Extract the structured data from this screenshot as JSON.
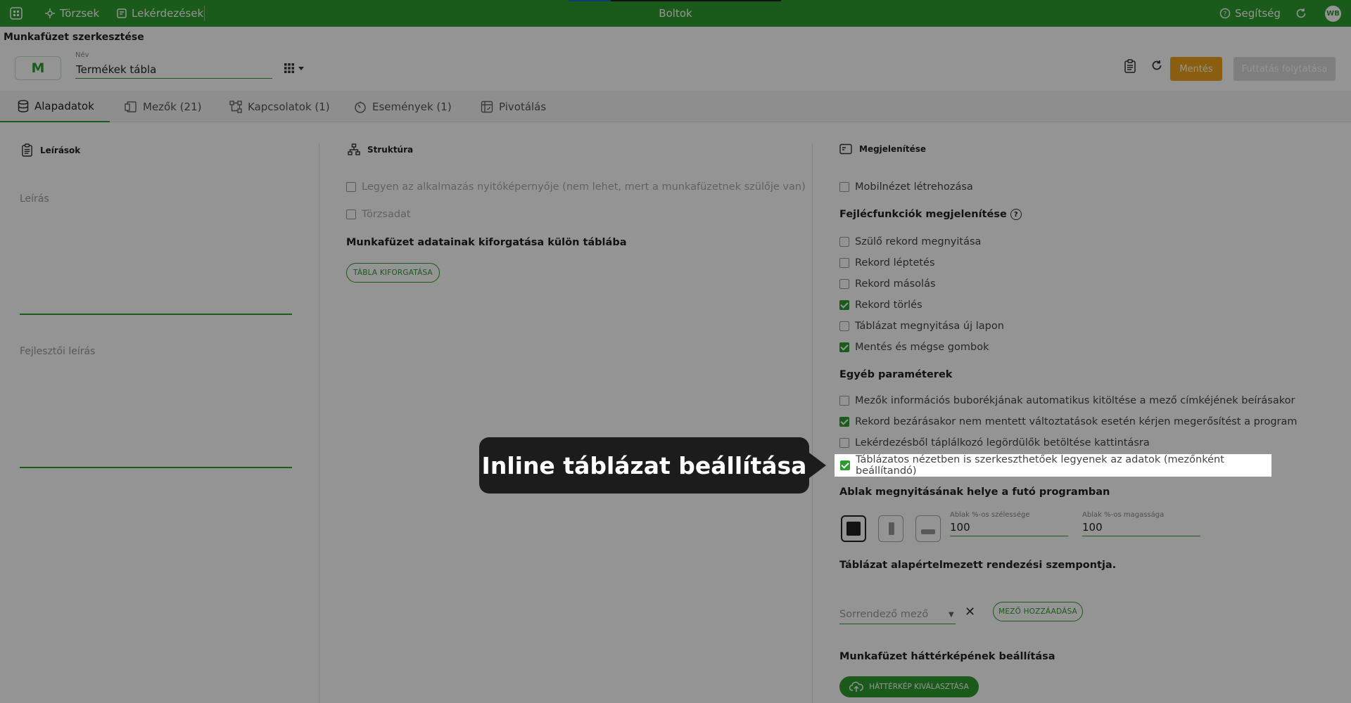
{
  "topbar": {
    "nav1": "Törzsek",
    "nav2": "Lekérdezések",
    "title": "Boltok",
    "help": "Segítség",
    "avatar": "WB",
    "color": "#2e9b2e"
  },
  "page_title": "Munkafüzet szerkesztése",
  "header": {
    "badge": "M",
    "name_label": "Név",
    "name_value": "Termékek tábla",
    "save": "Mentés",
    "run": "Futtatás folytatása",
    "save_color": "#f0a21b"
  },
  "tabs": [
    {
      "label": "Alapadatok",
      "icon": "database-icon"
    },
    {
      "label": "Mezők (21)",
      "icon": "fields-icon"
    },
    {
      "label": "Kapcsolatok (1)",
      "icon": "relations-icon"
    },
    {
      "label": "Események (1)",
      "icon": "events-icon"
    },
    {
      "label": "Pivotálás",
      "icon": "pivot-icon"
    }
  ],
  "left": {
    "title": "Leírások",
    "desc_label": "Leírás",
    "dev_desc_label": "Fejlesztői leírás"
  },
  "middle": {
    "title": "Struktúra",
    "checks": [
      {
        "label": "Legyen az alkalmazás nyitóképernyője (nem lehet, mert a munkafüzetnek szülője van)",
        "checked": false
      },
      {
        "label": "Törzsadat",
        "checked": false
      }
    ],
    "pivot_title": "Munkafüzet adatainak kiforgatása külön táblába",
    "pivot_button": "TÁBLA KIFORGATÁSA"
  },
  "right": {
    "title": "Megjelenítése",
    "mobile": {
      "label": "Mobilnézet létrehozása",
      "checked": false
    },
    "header_funcs_title": "Fejlécfunkciók megjelenítése",
    "header_funcs": [
      {
        "label": "Szülő rekord megnyitása",
        "checked": false
      },
      {
        "label": "Rekord léptetés",
        "checked": false
      },
      {
        "label": "Rekord másolás",
        "checked": false
      },
      {
        "label": "Rekord törlés",
        "checked": true
      },
      {
        "label": "Táblázat megnyitása új lapon",
        "checked": false
      },
      {
        "label": "Mentés és mégse gombok",
        "checked": true
      }
    ],
    "other_title": "Egyéb paraméterek",
    "other": [
      {
        "label": "Mezők információs buborékjának automatikus kitöltése a mező címkéjének beírásakor",
        "checked": false
      },
      {
        "label": "Rekord bezárásakor nem mentett változtatások esetén kérjen megerősítést a program",
        "checked": true
      },
      {
        "label": "Lekérdezésből táplálkozó legördülők betöltése kattintásra",
        "checked": false
      },
      {
        "label": "Táblázatos nézetben is szerkeszthetőek legyenek az adatok (mezőnként beállítandó)",
        "checked": true
      }
    ],
    "window_title": "Ablak megnyitásának helye a futó programban",
    "width_label": "Ablak %-os szélessége",
    "width_value": "100",
    "height_label": "Ablak %-os magassága",
    "height_value": "100",
    "sort_title": "Táblázat alapértelmezett rendezési szempontja.",
    "sort_placeholder": "Sorrendező mező",
    "add_field_button": "MEZŐ HOZZÁADÁSA",
    "bg_title": "Munkafüzet háttérképének beállítása",
    "bg_button": "HÁTTÉRKÉP KIVÁLASZTÁSA"
  },
  "tooltip": {
    "text": "Inline táblázat beállítása"
  }
}
